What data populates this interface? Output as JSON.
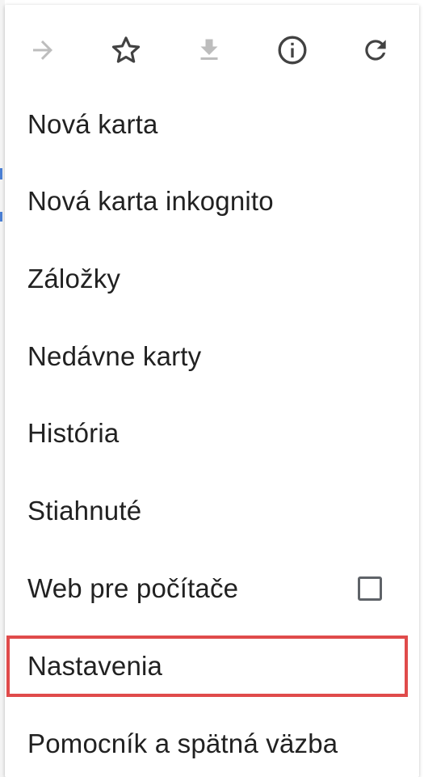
{
  "toolbar": {
    "icons": [
      {
        "name": "forward-arrow-icon",
        "enabled": false
      },
      {
        "name": "star-icon",
        "enabled": true
      },
      {
        "name": "download-icon",
        "enabled": false
      },
      {
        "name": "info-icon",
        "enabled": true
      },
      {
        "name": "reload-icon",
        "enabled": true
      }
    ]
  },
  "menu": {
    "items": [
      {
        "label": "Nová karta"
      },
      {
        "label": "Nová karta inkognito"
      },
      {
        "label": "Záložky"
      },
      {
        "label": "Nedávne karty"
      },
      {
        "label": "História"
      },
      {
        "label": "Stiahnuté"
      },
      {
        "label": "Web pre počítače",
        "checked": false
      },
      {
        "label": "Nastavenia",
        "highlighted": true
      },
      {
        "label": "Pomocník a spätná väzba"
      }
    ]
  },
  "colors": {
    "highlight_border": "#e04b4b",
    "text": "#212121",
    "icon": "#5f6368",
    "icon_disabled": "#bdbdbd"
  }
}
